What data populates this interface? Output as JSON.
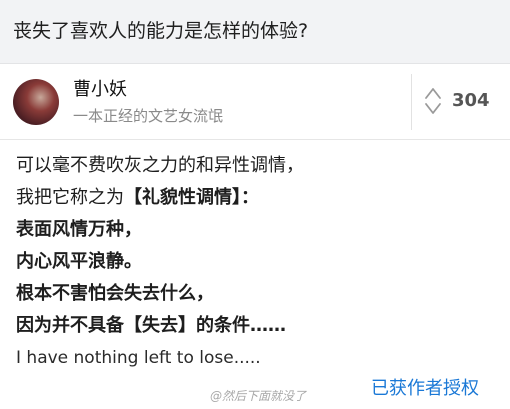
{
  "question": {
    "title": "丧失了喜欢人的能力是怎样的体验?"
  },
  "author": {
    "name": "曹小妖",
    "bio": "一本正经的文艺女流氓"
  },
  "vote": {
    "count": "304",
    "icon": "up-down-vote-arrows"
  },
  "answer": {
    "line1": "可以毫不费吹灰之力的和异性调情，",
    "line2_prefix": "我把它称之为",
    "line2_bold": "【礼貌性调情】：",
    "line3": "表面风情万种，",
    "line4": "内心风平浪静。",
    "line5": "根本不害怕会失去什么，",
    "line6": "因为并不具备【失去】的条件……",
    "line7": "I have nothing left to lose....."
  },
  "footer": {
    "authorized_label": "已获作者授权",
    "watermark": "@然后下面就没了"
  },
  "colors": {
    "link_blue": "#1a78d6",
    "header_bg": "#f2f3f5"
  }
}
